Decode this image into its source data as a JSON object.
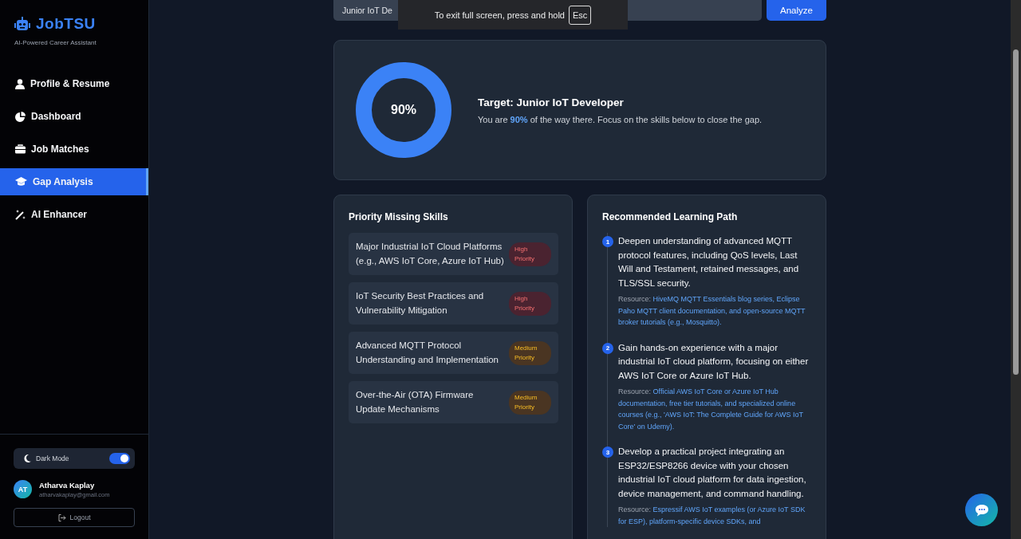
{
  "sidebar": {
    "brand": "JobTSU",
    "tagline": "AI-Powered Career Assistant",
    "items": [
      {
        "label": "Profile & Resume",
        "selected": false
      },
      {
        "label": "Dashboard",
        "selected": false
      },
      {
        "label": "Job Matches",
        "selected": false
      },
      {
        "label": "Gap Analysis",
        "selected": true
      },
      {
        "label": "AI Enhancer",
        "selected": false
      }
    ],
    "dark_mode": {
      "label": "Dark Mode",
      "on": true
    },
    "user": {
      "initials": "AT",
      "name": "Atharva Kaplay",
      "email": "atharvakaplay@gmail.com"
    },
    "logout": "Logout"
  },
  "search": {
    "value": "Junior IoT De",
    "button": "Analyze"
  },
  "fullscreen_notice": {
    "text": "To exit full screen, press and hold",
    "key": "Esc"
  },
  "score": {
    "percent": "90%",
    "title": "Target: Junior IoT Developer",
    "message": "You are **90%** of the way there. Focus on the skills below to close the gap."
  },
  "missing_skills": {
    "title": "Priority Missing Skills",
    "items": [
      {
        "name": "Major Industrial IoT Cloud Platforms (e.g., AWS IoT Core, Azure IoT Hub)",
        "priority": "High Priority",
        "kind": "high"
      },
      {
        "name": "IoT Security Best Practices and Vulnerability Mitigation",
        "priority": "High Priority",
        "kind": "high"
      },
      {
        "name": "Advanced MQTT Protocol Understanding and Implementation",
        "priority": "Medium Priority",
        "kind": "medium"
      },
      {
        "name": "Over-the-Air (OTA) Firmware Update Mechanisms",
        "priority": "Medium Priority",
        "kind": "medium"
      }
    ]
  },
  "learning_path": {
    "title": "Recommended Learning Path",
    "steps": [
      {
        "number": "1",
        "text": "Deepen understanding of advanced MQTT protocol features, including QoS levels, Last Will and Testament, retained messages, and TLS/SSL security.",
        "resource_label": "Resource:",
        "resource": "HiveMQ MQTT Essentials blog series, Eclipse Paho MQTT client documentation, and open-source MQTT broker tutorials (e.g., Mosquitto)."
      },
      {
        "number": "2",
        "text": "Gain hands-on experience with a major industrial IoT cloud platform, focusing on either AWS IoT Core or Azure IoT Hub.",
        "resource_label": "Resource:",
        "resource": "Official AWS IoT Core or Azure IoT Hub documentation, free tier tutorials, and specialized online courses (e.g., 'AWS IoT: The Complete Guide for AWS IoT Core' on Udemy)."
      },
      {
        "number": "3",
        "text": "Develop a practical project integrating an ESP32/ESP8266 device with your chosen industrial IoT cloud platform for data ingestion, device management, and command handling.",
        "resource_label": "Resource:",
        "resource": "Espressif AWS IoT examples (or Azure IoT SDK for ESP), platform-specific device SDKs, and"
      }
    ]
  }
}
